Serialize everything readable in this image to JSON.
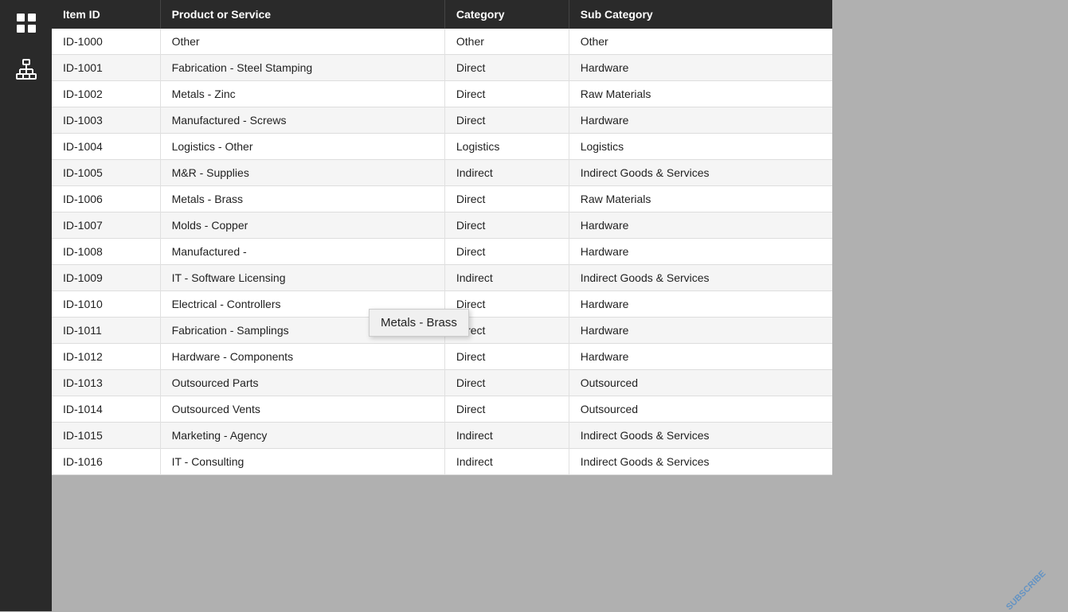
{
  "sidebar": {
    "icons": [
      {
        "name": "grid-icon",
        "label": "Grid"
      },
      {
        "name": "hierarchy-icon",
        "label": "Hierarchy"
      }
    ]
  },
  "table": {
    "columns": [
      "Item ID",
      "Product or Service",
      "Category",
      "Sub Category"
    ],
    "rows": [
      {
        "id": "ID-1000",
        "product": "Other",
        "category": "Other",
        "subcategory": "Other"
      },
      {
        "id": "ID-1001",
        "product": "Fabrication - Steel Stamping",
        "category": "Direct",
        "subcategory": "Hardware"
      },
      {
        "id": "ID-1002",
        "product": "Metals - Zinc",
        "category": "Direct",
        "subcategory": "Raw Materials"
      },
      {
        "id": "ID-1003",
        "product": "Manufactured - Screws",
        "category": "Direct",
        "subcategory": "Hardware"
      },
      {
        "id": "ID-1004",
        "product": "Logistics - Other",
        "category": "Logistics",
        "subcategory": "Logistics"
      },
      {
        "id": "ID-1005",
        "product": "M&R - Supplies",
        "category": "Indirect",
        "subcategory": "Indirect Goods & Services"
      },
      {
        "id": "ID-1006",
        "product": "Metals - Brass",
        "category": "Direct",
        "subcategory": "Raw Materials"
      },
      {
        "id": "ID-1007",
        "product": "Molds - Copper",
        "category": "Direct",
        "subcategory": "Hardware"
      },
      {
        "id": "ID-1008",
        "product": "Manufactured -",
        "category": "Direct",
        "subcategory": "Hardware"
      },
      {
        "id": "ID-1009",
        "product": "IT - Software Licensing",
        "category": "Indirect",
        "subcategory": "Indirect Goods & Services"
      },
      {
        "id": "ID-1010",
        "product": "Electrical - Controllers",
        "category": "Direct",
        "subcategory": "Hardware"
      },
      {
        "id": "ID-1011",
        "product": "Fabrication - Samplings",
        "category": "Direct",
        "subcategory": "Hardware"
      },
      {
        "id": "ID-1012",
        "product": "Hardware - Components",
        "category": "Direct",
        "subcategory": "Hardware"
      },
      {
        "id": "ID-1013",
        "product": "Outsourced Parts",
        "category": "Direct",
        "subcategory": "Outsourced"
      },
      {
        "id": "ID-1014",
        "product": "Outsourced Vents",
        "category": "Direct",
        "subcategory": "Outsourced"
      },
      {
        "id": "ID-1015",
        "product": "Marketing - Agency",
        "category": "Indirect",
        "subcategory": "Indirect Goods & Services"
      },
      {
        "id": "ID-1016",
        "product": "IT - Consulting",
        "category": "Indirect",
        "subcategory": "Indirect Goods & Services"
      }
    ]
  },
  "tooltip": {
    "text": "Metals - Brass"
  },
  "watermark": {
    "text": "SUBSCRIBE"
  }
}
